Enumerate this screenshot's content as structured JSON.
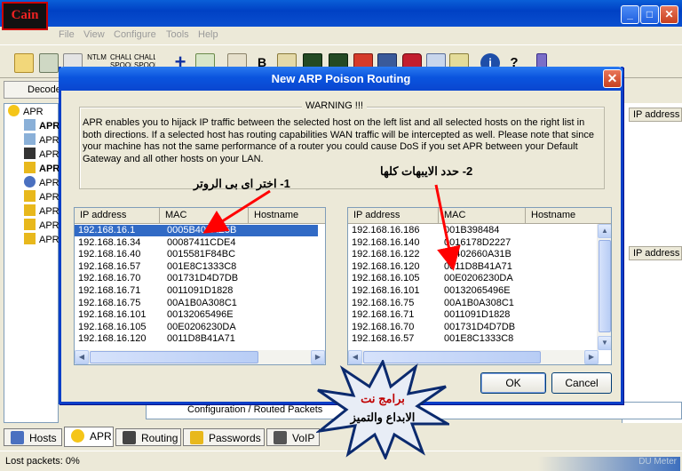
{
  "app": {
    "logo_text": "Cain",
    "menu": [
      "File",
      "View",
      "Configure",
      "Tools",
      "Help"
    ],
    "toolbar_labels": [
      "NTLM",
      "CHALL SPOOF",
      "CHALL SPOOF"
    ],
    "decode_tab": "Decode",
    "tree": [
      "APR",
      "APR",
      "APR",
      "APR",
      "APR",
      "APR",
      "APR",
      "APR",
      "APR",
      "APR"
    ],
    "right_headers": [
      "IP address",
      "IP address"
    ],
    "status_row": "Configuration / Routed Packets",
    "bottom_tabs": [
      "Hosts",
      "APR",
      "Routing",
      "Passwords",
      "VoIP"
    ],
    "status_text": "Lost packets:  0%",
    "meter_text": "DU Meter"
  },
  "dialog": {
    "title": "New ARP Poison Routing",
    "warning_title": "WARNING !!!",
    "warning_text": "APR enables you to hijack IP traffic between the selected host on the left list and all selected hosts on the right list in both directions. If a selected host has routing capabilities WAN traffic will be intercepted as well. Please note that since your machine has not the same performance of a router you could cause DoS if you set APR between your Default Gateway and all other hosts on your LAN.",
    "columns": [
      "IP address",
      "MAC",
      "Hostname"
    ],
    "left_rows": [
      {
        "ip": "192.168.16.1",
        "mac": "0005B404AE5B"
      },
      {
        "ip": "192.168.16.34",
        "mac": "00087411CDE4"
      },
      {
        "ip": "192.168.16.40",
        "mac": "0015581F84BC"
      },
      {
        "ip": "192.168.16.57",
        "mac": "001E8C1333C8"
      },
      {
        "ip": "192.168.16.70",
        "mac": "001731D4D7DB"
      },
      {
        "ip": "192.168.16.71",
        "mac": "0011091D1828"
      },
      {
        "ip": "192.168.16.75",
        "mac": "00A1B0A308C1"
      },
      {
        "ip": "192.168.16.101",
        "mac": "00132065496E"
      },
      {
        "ip": "192.168.16.105",
        "mac": "00E0206230DA"
      },
      {
        "ip": "192.168.16.120",
        "mac": "0011D8B41A71"
      }
    ],
    "right_rows": [
      {
        "ip": "192.168.16.186",
        "mac": "001B398484"
      },
      {
        "ip": "192.168.16.140",
        "mac": "0016178D2227"
      },
      {
        "ip": "192.168.16.122",
        "mac": "00402660A31B"
      },
      {
        "ip": "192.168.16.120",
        "mac": "0011D8B41A71"
      },
      {
        "ip": "192.168.16.105",
        "mac": "00E0206230DA"
      },
      {
        "ip": "192.168.16.101",
        "mac": "00132065496E"
      },
      {
        "ip": "192.168.16.75",
        "mac": "00A1B0A308C1"
      },
      {
        "ip": "192.168.16.71",
        "mac": "0011091D1828"
      },
      {
        "ip": "192.168.16.70",
        "mac": "001731D4D7DB"
      },
      {
        "ip": "192.168.16.57",
        "mac": "001E8C1333C8"
      }
    ],
    "ok_label": "OK",
    "cancel_label": "Cancel"
  },
  "annotations": {
    "step1": "1- اختر اى بى الروتر",
    "step2": "2- حدد الايبهات كلها",
    "burst_line1": "برامج نت",
    "burst_line2": "الابداع والتميز"
  },
  "colors": {
    "titlebar": "#0a54de",
    "selection": "#316ac5",
    "arrow": "#ff0000",
    "burst_text": "#c00000"
  }
}
